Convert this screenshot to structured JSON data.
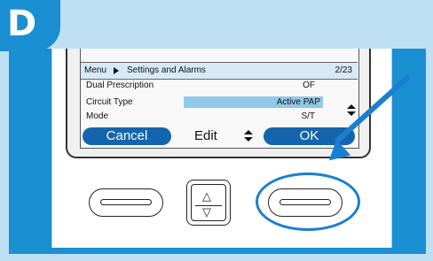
{
  "step": {
    "letter": "D"
  },
  "screen": {
    "breadcrumb": "Menu",
    "section": "Settings and Alarms",
    "page": "2/23",
    "rows": [
      {
        "label": "Dual Prescription",
        "value": "OF"
      },
      {
        "label": "Circuit Type",
        "value": "Active PAP",
        "selected": true
      },
      {
        "label": "Mode",
        "value": "S/T"
      }
    ],
    "softkeys": {
      "left": "Cancel",
      "center": "Edit",
      "right": "OK"
    }
  },
  "colors": {
    "accent": "#1a8fd2",
    "panel": "#bfe0f3",
    "pill": "#1465ad",
    "highlight": "#91c9e7"
  },
  "icons": [
    "menu-arrow-icon",
    "up-down-icon",
    "arrow-pointer-icon",
    "highlight-ring-icon"
  ]
}
